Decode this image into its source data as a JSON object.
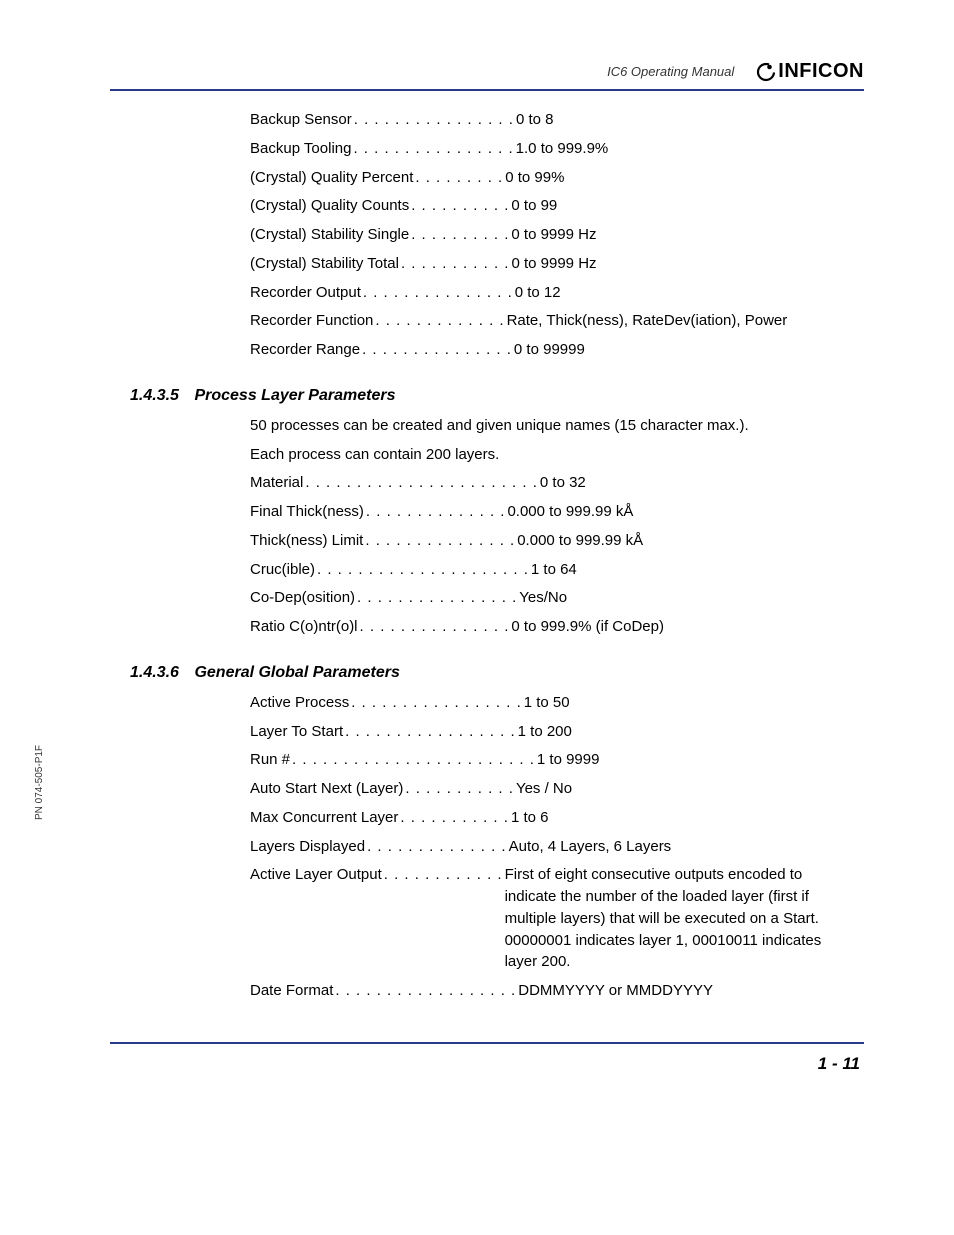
{
  "header": {
    "manual_title": "IC6 Operating Manual",
    "brand": "INFICON"
  },
  "side_label": "PN 074-505-P1F",
  "top_params": [
    {
      "label": "Backup Sensor",
      "value": "0 to 8"
    },
    {
      "label": "Backup Tooling",
      "value": "1.0 to 999.9%"
    },
    {
      "label": "(Crystal) Quality Percent",
      "value": "0 to 99%"
    },
    {
      "label": "(Crystal) Quality Counts",
      "value": "0 to 99"
    },
    {
      "label": "(Crystal) Stability Single",
      "value": "0 to 9999 Hz"
    },
    {
      "label": "(Crystal) Stability Total",
      "value": "0 to 9999 Hz"
    },
    {
      "label": "Recorder Output",
      "value": "0 to 12"
    },
    {
      "label": "Recorder Function",
      "value": "Rate, Thick(ness), RateDev(iation), Power"
    },
    {
      "label": "Recorder Range",
      "value": "0 to 99999"
    }
  ],
  "section_1435": {
    "number": "1.4.3.5",
    "title": "Process Layer Parameters",
    "intro_line1": "50 processes can be created and given unique names (15 character max.).",
    "intro_line2": "Each process can contain 200 layers.",
    "params": [
      {
        "label": "Material",
        "value": "0 to 32"
      },
      {
        "label": "Final Thick(ness)",
        "value": "0.000 to 999.99 kÅ"
      },
      {
        "label": "Thick(ness) Limit",
        "value": "0.000 to 999.99 kÅ"
      },
      {
        "label": "Cruc(ible)",
        "value": "1 to 64"
      },
      {
        "label": "Co-Dep(osition)",
        "value": "Yes/No"
      },
      {
        "label": "Ratio C(o)ntr(o)l",
        "value": "0 to 999.9% (if CoDep)"
      }
    ]
  },
  "section_1436": {
    "number": "1.4.3.6",
    "title": "General Global Parameters",
    "params": [
      {
        "label": "Active Process",
        "value": "1 to 50"
      },
      {
        "label": "Layer To Start",
        "value": "1 to 200"
      },
      {
        "label": "Run #",
        "value": "1 to 9999"
      },
      {
        "label": "Auto Start Next (Layer)",
        "value": "Yes / No"
      },
      {
        "label": "Max Concurrent Layer",
        "value": "1 to 6"
      },
      {
        "label": "Layers Displayed",
        "value": "Auto, 4 Layers, 6 Layers"
      },
      {
        "label": "Active Layer Output",
        "value": "First of eight consecutive outputs encoded to indicate the number of the loaded layer (first if multiple layers) that will be executed on a Start. 00000001 indicates layer 1, 00010011 indicates layer 200."
      },
      {
        "label": "Date Format",
        "value": "DDMMYYYY or MMDDYYYY"
      }
    ]
  },
  "footer": {
    "page_number": "1 - 11"
  },
  "leader_widths": {
    "top_params": [
      16,
      16,
      9,
      10,
      10,
      11,
      15,
      13,
      15
    ],
    "section_1435": [
      23,
      14,
      15,
      21,
      16,
      15
    ],
    "section_1436": [
      17,
      17,
      24,
      11,
      11,
      14,
      12,
      18
    ]
  }
}
